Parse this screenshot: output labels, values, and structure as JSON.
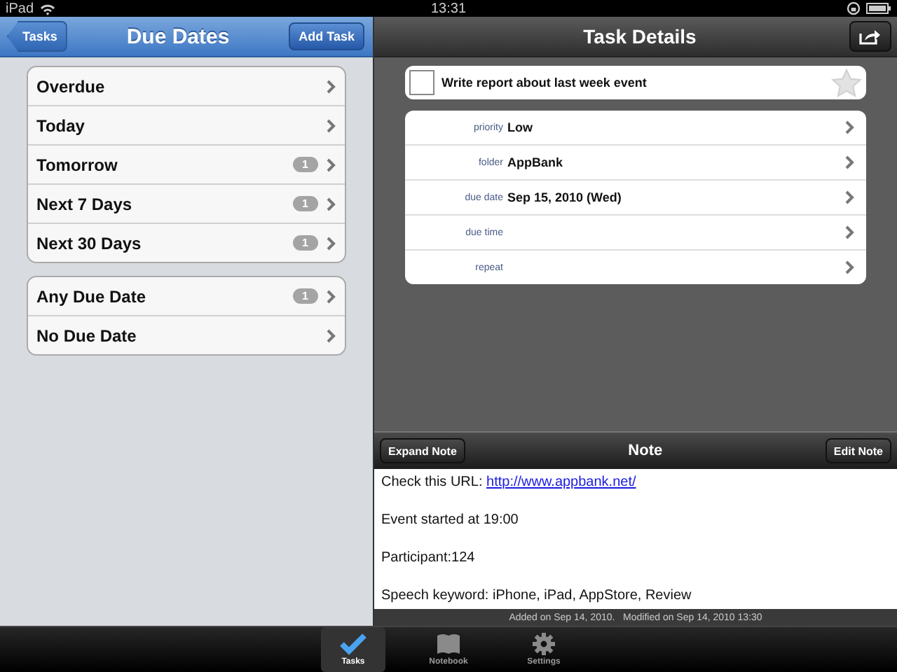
{
  "status_bar": {
    "device": "iPad",
    "time": "13:31"
  },
  "left": {
    "nav": {
      "back": "Tasks",
      "title": "Due Dates",
      "action": "Add Task"
    },
    "groups": [
      [
        {
          "label": "Overdue"
        },
        {
          "label": "Today"
        },
        {
          "label": "Tomorrow",
          "badge": "1"
        },
        {
          "label": "Next 7 Days",
          "badge": "1"
        },
        {
          "label": "Next 30 Days",
          "badge": "1"
        }
      ],
      [
        {
          "label": "Any Due Date",
          "badge": "1"
        },
        {
          "label": "No Due Date"
        }
      ]
    ]
  },
  "right": {
    "title": "Task Details",
    "task": {
      "title": "Write report about last week event",
      "completed": false,
      "starred": false
    },
    "fields": [
      {
        "label": "priority",
        "value": "Low"
      },
      {
        "label": "folder",
        "value": "AppBank"
      },
      {
        "label": "due date",
        "value": "Sep 15, 2010 (Wed)"
      },
      {
        "label": "due time"
      },
      {
        "label": "repeat"
      }
    ],
    "note": {
      "title": "Note",
      "expand_button": "Expand Note",
      "edit_button": "Edit Note",
      "lines": [
        {
          "text": "Check this URL: ",
          "link": "http://www.appbank.net/"
        },
        {
          "text": "Event started at 19:00"
        },
        {
          "text": "Participant:124"
        },
        {
          "text": "Speech keyword: iPhone, iPad, AppStore, Review"
        }
      ],
      "footer": "Added on Sep 14, 2010.   Modified on Sep 14, 2010 13:30"
    }
  },
  "tab_bar": [
    {
      "label": "Tasks",
      "kind": "check",
      "selected": true
    },
    {
      "label": "Notebook",
      "kind": "book",
      "selected": false
    },
    {
      "label": "Settings",
      "kind": "gear",
      "selected": false
    }
  ]
}
